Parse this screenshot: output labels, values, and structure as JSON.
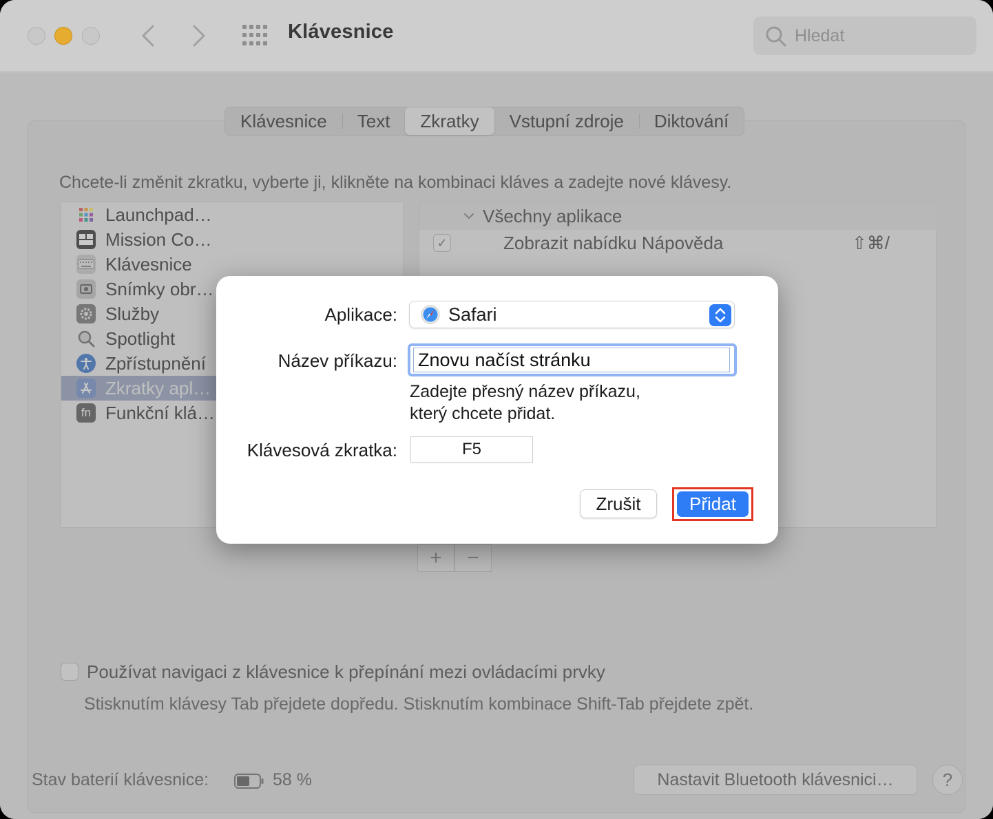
{
  "window": {
    "title": "Klávesnice",
    "search_placeholder": "Hledat"
  },
  "tabs": [
    {
      "label": "Klávesnice",
      "active": false
    },
    {
      "label": "Text",
      "active": false
    },
    {
      "label": "Zkratky",
      "active": true
    },
    {
      "label": "Vstupní zdroje",
      "active": false
    },
    {
      "label": "Diktování",
      "active": false
    }
  ],
  "instruction": "Chcete-li změnit zkratku, vyberte ji, klikněte na kombinaci kláves a zadejte nové klávesy.",
  "categories": [
    {
      "label": "Launchpad…",
      "icon": "launchpad-icon"
    },
    {
      "label": "Mission Co…",
      "icon": "mission-control-icon"
    },
    {
      "label": "Klávesnice",
      "icon": "keyboard-icon"
    },
    {
      "label": "Snímky obr…",
      "icon": "screenshot-icon"
    },
    {
      "label": "Služby",
      "icon": "gear-icon"
    },
    {
      "label": "Spotlight",
      "icon": "magnifier-icon"
    },
    {
      "label": "Zpřístupnění",
      "icon": "accessibility-icon"
    },
    {
      "label": "Zkratky apl…",
      "icon": "app-store-icon",
      "selected": true
    },
    {
      "label": "Funkční klá…",
      "icon": "fn-key-icon",
      "glyph": "fn"
    }
  ],
  "shortcuts": {
    "group_label": "Všechny aplikace",
    "rows": [
      {
        "checked": true,
        "label": "Zobrazit nabídku Nápověda",
        "keys": "⇧⌘/"
      }
    ],
    "add_label": "+",
    "remove_label": "−"
  },
  "keyboard_nav": {
    "label": "Používat navigaci z klávesnice k přepínání mezi ovládacími prvky",
    "hint": "Stisknutím klávesy Tab přejdete dopředu. Stisknutím kombinace Shift-Tab přejdete zpět.",
    "checked": false
  },
  "footer": {
    "battery_label": "Stav baterií klávesnice:",
    "battery_value": "58 %",
    "battery_level": 0.58,
    "bluetooth_button": "Nastavit Bluetooth klávesnici…",
    "help_label": "?"
  },
  "dialog": {
    "app_label": "Aplikace:",
    "app_value": "Safari",
    "command_label": "Název příkazu:",
    "command_value": "Znovu načíst stránku",
    "help_line1": "Zadejte přesný název příkazu,",
    "help_line2": "který chcete přidat.",
    "shortcut_label": "Klávesová zkratka:",
    "shortcut_value": "F5",
    "cancel_label": "Zrušit",
    "add_label": "Přidat",
    "accent_color": "#2e7cf6",
    "highlight_color": "#e23524"
  }
}
